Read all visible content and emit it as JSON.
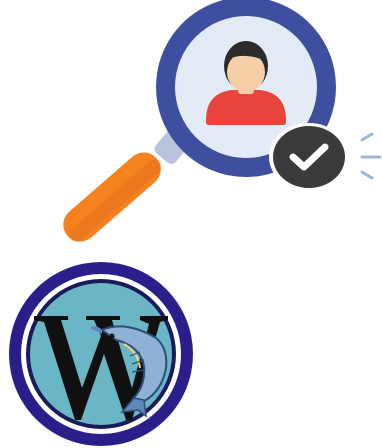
{
  "illustration": {
    "icon": "user-search-verified-icon",
    "colors": {
      "lens_ring": "#3f4fa0",
      "lens_inner": "#e3ebf7",
      "handle": "#f5821f",
      "handle_shade": "#d9681a",
      "user_head": "#f5d0a8",
      "user_hair": "#2b2b2b",
      "user_shirt": "#e8453c",
      "badge": "#3a3a3a",
      "check": "#ffffff",
      "sparkle": "#9fb4d8"
    }
  },
  "logo": {
    "icon": "wordpress-fish-logo",
    "letter": "W",
    "colors": {
      "outer_ring": "#2a1f8a",
      "inner_ring": "#ffffff",
      "field": "#6ab6c7",
      "letter": "#101010",
      "fish": "#8fb1d6"
    }
  }
}
